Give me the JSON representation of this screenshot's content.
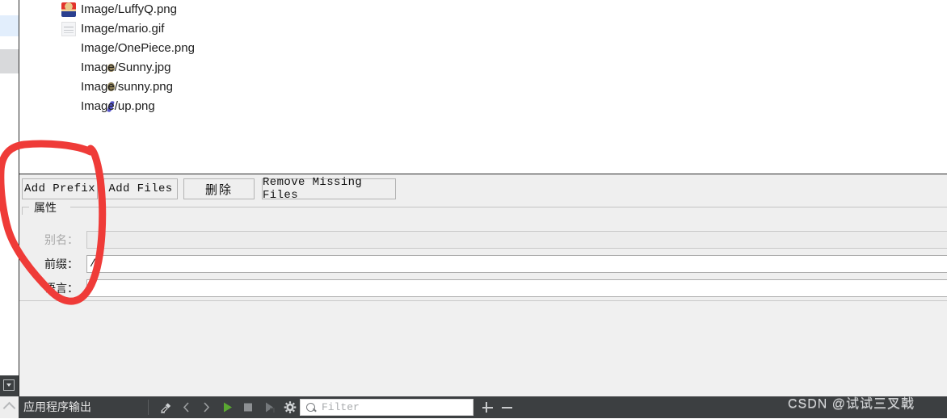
{
  "file_list": {
    "items": [
      {
        "label": "Image/LuffyQ.png",
        "icon": "luffy-thumbnail-icon"
      },
      {
        "label": "Image/mario.gif",
        "icon": "mario-thumbnail-icon"
      },
      {
        "label": "Image/OnePiece.png",
        "icon": "onepiece-thumbnail-icon"
      },
      {
        "label": "Image/Sunny.jpg",
        "icon": "sunny-jpg-thumbnail-icon"
      },
      {
        "label": "Image/sunny.png",
        "icon": "sunny-png-thumbnail-icon"
      },
      {
        "label": "Image/up.png",
        "icon": "up-thumbnail-icon"
      }
    ]
  },
  "toolbar": {
    "add_prefix_label": "Add Prefix",
    "add_files_label": "Add Files",
    "delete_label": "删除",
    "remove_missing_label": "Remove Missing Files"
  },
  "properties": {
    "group_title": "属性",
    "fields": [
      {
        "label": "别名：",
        "value": "",
        "enabled": false
      },
      {
        "label": "前缀：",
        "value": "/",
        "enabled": true
      },
      {
        "label": "语言：",
        "value": "",
        "enabled": true
      }
    ]
  },
  "bottom_bar": {
    "output_title": "应用程序输出",
    "filter_placeholder": "Filter",
    "icons": [
      "clean-pane-icon",
      "prev-item-icon",
      "next-item-icon",
      "run-icon",
      "stop-icon",
      "rerun-icon",
      "settings-gear-icon"
    ],
    "zoom_in_label": "+",
    "zoom_out_label": "−"
  },
  "watermark": {
    "text": "CSDN @试试三叉戟"
  },
  "annotation": {
    "color": "#ef3b38",
    "shape": "hand-drawn-circle"
  },
  "colors": {
    "panel_bg": "#efefef",
    "list_bg": "#ffffff",
    "bottom_bar_bg": "#3c3f41",
    "rail_highlight": "#e2eefc",
    "rail_selected": "#d8d9db",
    "run_green": "#5aa832",
    "annotation_red": "#ef3b38"
  }
}
